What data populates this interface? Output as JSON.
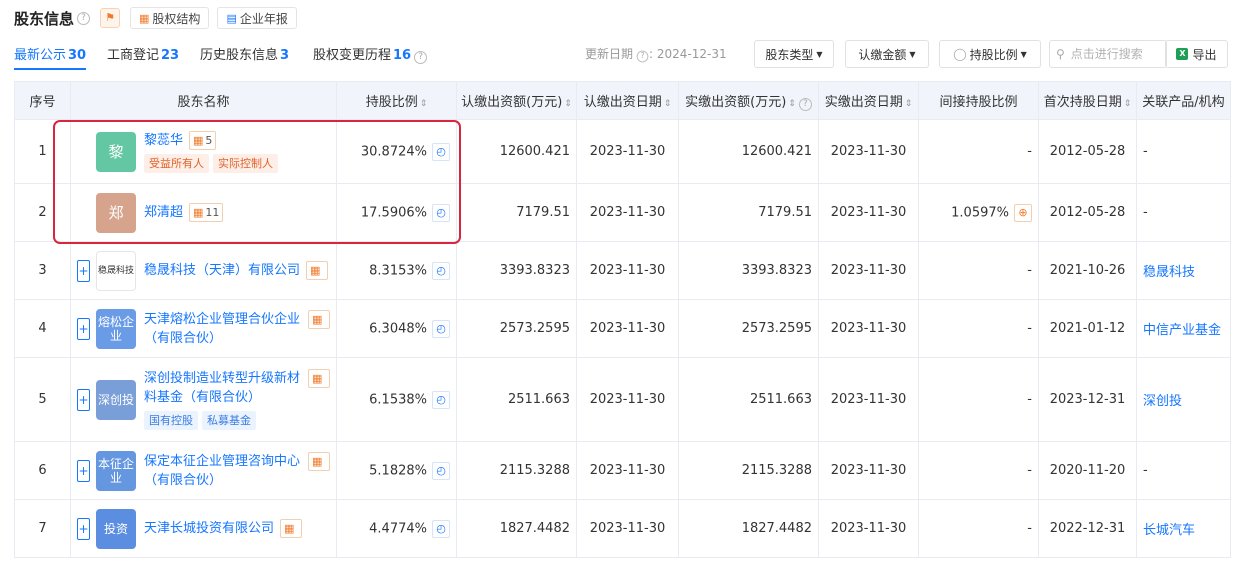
{
  "header": {
    "title": "股东信息",
    "help_glyph": "?",
    "bell_icon": "bell-icon",
    "buttons": [
      {
        "label": "股权结构",
        "icon": "org-chart-icon"
      },
      {
        "label": "企业年报",
        "icon": "document-icon"
      }
    ]
  },
  "tabs": [
    {
      "label": "最新公示",
      "count": "30",
      "active": true
    },
    {
      "label": "工商登记",
      "count": "23"
    },
    {
      "label": "历史股东信息",
      "count": "3"
    },
    {
      "label": "股权变更历程",
      "count": "16"
    }
  ],
  "toolbar": {
    "update_label": "更新日期",
    "update_date": "2024-12-31",
    "filters": [
      "股东类型",
      "认缴金额",
      "持股比例"
    ],
    "search_placeholder": "点击进行搜索",
    "export_label": "导出"
  },
  "table": {
    "columns": [
      "序号",
      "股东名称",
      "持股比例",
      "认缴出资额(万元)",
      "认缴出资日期",
      "实缴出资额(万元)",
      "实缴出资日期",
      "间接持股比例",
      "首次持股日期",
      "关联产品/机构"
    ],
    "rows": [
      {
        "index": "1",
        "name": "黎蕊华",
        "logo": "黎",
        "logo_color": "#63c7a3",
        "struct_count": "5",
        "tags": [
          {
            "text": "受益所有人",
            "color": "red"
          },
          {
            "text": "实际控制人",
            "color": "red"
          }
        ],
        "ratio": "30.8724%",
        "sub_amount": "12600.421",
        "sub_date": "2023-11-30",
        "paid_amount": "12600.421",
        "paid_date": "2023-11-30",
        "indirect": "-",
        "first_date": "2012-05-28",
        "related": "-"
      },
      {
        "index": "2",
        "name": "郑清超",
        "logo": "郑",
        "logo_color": "#d6a38c",
        "struct_count": "11",
        "tags": [],
        "ratio": "17.5906%",
        "sub_amount": "7179.51",
        "sub_date": "2023-11-30",
        "paid_amount": "7179.51",
        "paid_date": "2023-11-30",
        "indirect": "1.0597%",
        "first_date": "2012-05-28",
        "related": "-"
      },
      {
        "index": "3",
        "name": "稳晟科技（天津）有限公司",
        "logo": "稳晟科技",
        "logo_color": "#ffffff",
        "struct_count": "",
        "tags": [],
        "ratio": "8.3153%",
        "sub_amount": "3393.8323",
        "sub_date": "2023-11-30",
        "paid_amount": "3393.8323",
        "paid_date": "2023-11-30",
        "indirect": "-",
        "first_date": "2021-10-26",
        "related": "稳晟科技"
      },
      {
        "index": "4",
        "name": "天津熔松企业管理合伙企业（有限合伙）",
        "logo": "熔松企业",
        "logo_color": "#6a9be6",
        "struct_count": "",
        "tags": [],
        "ratio": "6.3048%",
        "sub_amount": "2573.2595",
        "sub_date": "2023-11-30",
        "paid_amount": "2573.2595",
        "paid_date": "2023-11-30",
        "indirect": "-",
        "first_date": "2021-01-12",
        "related": "中信产业基金"
      },
      {
        "index": "5",
        "name": "深创投制造业转型升级新材料基金（有限合伙）",
        "logo": "深创投",
        "logo_color": "#7a9fd8",
        "struct_count": "",
        "tags": [
          {
            "text": "国有控股",
            "color": "blue"
          },
          {
            "text": "私募基金",
            "color": "blue"
          }
        ],
        "ratio": "6.1538%",
        "sub_amount": "2511.663",
        "sub_date": "2023-11-30",
        "paid_amount": "2511.663",
        "paid_date": "2023-11-30",
        "indirect": "-",
        "first_date": "2023-12-31",
        "related": "深创投"
      },
      {
        "index": "6",
        "name": "保定本征企业管理咨询中心（有限合伙）",
        "logo": "本征企业",
        "logo_color": "#6596e0",
        "struct_count": "",
        "tags": [],
        "ratio": "5.1828%",
        "sub_amount": "2115.3288",
        "sub_date": "2023-11-30",
        "paid_amount": "2115.3288",
        "paid_date": "2023-11-30",
        "indirect": "-",
        "first_date": "2020-11-20",
        "related": "-"
      },
      {
        "index": "7",
        "name": "天津长城投资有限公司",
        "logo": "投资",
        "logo_color": "#5b8ee0",
        "struct_count": "",
        "tags": [],
        "ratio": "4.4774%",
        "sub_amount": "1827.4482",
        "sub_date": "2023-11-30",
        "paid_amount": "1827.4482",
        "paid_date": "2023-11-30",
        "indirect": "-",
        "first_date": "2022-12-31",
        "related": "长城汽车"
      }
    ]
  }
}
